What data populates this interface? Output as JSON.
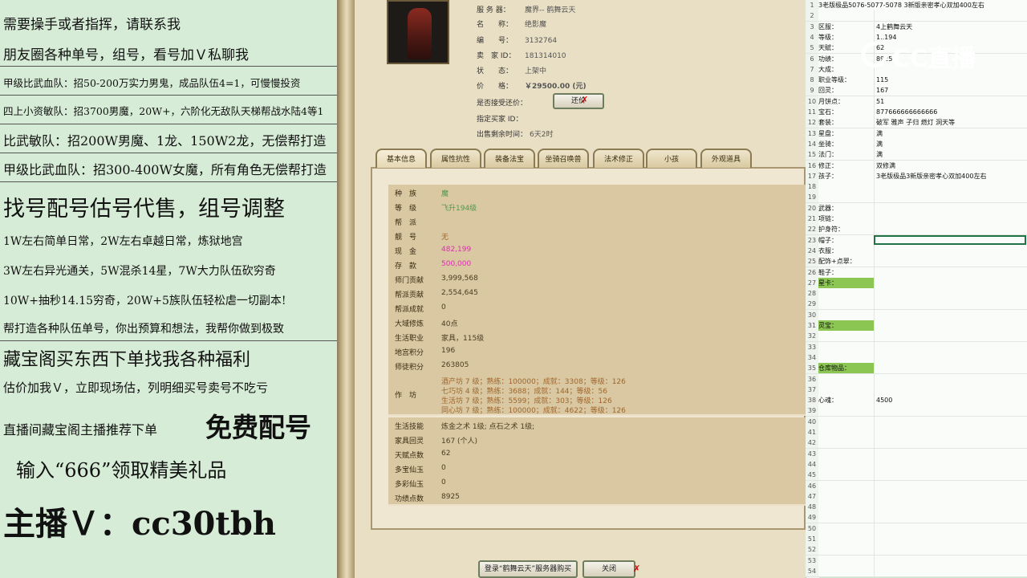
{
  "left_panel": {
    "lines": [
      "需要操手或者指挥，请联系我",
      "朋友圈各种单号，组号，看号加Ｖ私聊我",
      "甲级比武血队：招50-200万实力男鬼，成品队伍4=1，可慢慢投资",
      "四上小资敏队：招3700男魔，20W+，六阶化无敌队天梯帮战水陆4等1",
      "比武敏队：招200W男魔、1龙、150W2龙，无偿帮打造",
      "甲级比武血队：招300-400W女魔，所有角色无偿帮打造",
      "找号配号估号代售，组号调整",
      "1W左右简单日常，2W左右卓越日常，炼狱地宫",
      "3W左右异光通关，5W混杀14星，7W大力队伍砍穷奇",
      "10W+抽秒14.15穷奇，20W+5族队伍轻松虐一切副本!",
      "帮打造各种队伍单号，你出预算和想法，我帮你做到极致",
      "藏宝阁买东西下单找我各种福利",
      "估价加我Ｖ，立即现场估，列明细买号卖号不吃亏",
      "直播间藏宝阁主播推荐下单",
      "免费配号",
      "输入“666”领取精美礼品",
      "主播Ｖ：cc30tbh"
    ]
  },
  "item": {
    "server_label": "服 务 器：",
    "server": "魔界-- 鹤舞云天",
    "name_label": "名　　称：",
    "name": "绝影魔",
    "id_label": "编　　号：",
    "id": "3132764",
    "seller_label": "卖　家 ID：",
    "seller": "181314010",
    "status_label": "状　　态：",
    "status": "上架中",
    "price_label": "价　　格：",
    "price": "￥29500.00 (元)",
    "counter_label": "是否接受还价：",
    "counter_button": "还价",
    "buyer_label": "指定买家 ID：",
    "buyer": "",
    "time_label": "出售剩余时间：",
    "time": "6天2时"
  },
  "tabs": [
    "基本信息",
    "属性抗性",
    "装备法宝",
    "坐骑召唤兽",
    "法术修正",
    "小孩",
    "外观道具"
  ],
  "info_rows": [
    {
      "label": "种　族",
      "value": "魔",
      "style": "green"
    },
    {
      "label": "等　级",
      "value": "飞升194级",
      "style": "green"
    },
    {
      "label": "帮　派",
      "value": "",
      "style": ""
    },
    {
      "label": "靓　号",
      "value": "无",
      "style": "orange"
    },
    {
      "label": "现　金",
      "value": "482,199",
      "style": "pink"
    },
    {
      "label": "存　款",
      "value": "500,000",
      "style": "pink"
    },
    {
      "label": "师门贡献",
      "value": "3,999,568",
      "style": ""
    },
    {
      "label": "帮派贡献",
      "value": "2,554,645",
      "style": ""
    },
    {
      "label": "帮派成就",
      "value": "0",
      "style": ""
    },
    {
      "label": "大域修炼",
      "value": "40点",
      "style": ""
    },
    {
      "label": "生活职业",
      "value": "家具，115级",
      "style": ""
    },
    {
      "label": "地宫积分",
      "value": "196",
      "style": ""
    },
    {
      "label": "师徒积分",
      "value": "263805",
      "style": ""
    }
  ],
  "workshop": {
    "label": "作　坊",
    "lines": [
      "酒产坊 7 级；熟练：100000；成就：3308；等级：126",
      "七巧坊 4 级；熟练：3688；成就：144；等级：56",
      "生活坊 7 级；熟练：5599；成就：303；等级：126",
      "同心坊 7 级；熟练：100000；成就：4622；等级：126"
    ]
  },
  "info_rows2": [
    {
      "label": "生活技能",
      "value": "炼金之术 1级; 点石之术 1级;"
    },
    {
      "label": "家具回灵",
      "value": "167 (个人)"
    },
    {
      "label": "天赋点数",
      "value": "62"
    },
    {
      "label": "多宝仙玉",
      "value": "0"
    },
    {
      "label": "多彩仙玉",
      "value": "0"
    },
    {
      "label": "功绩点数",
      "value": "8925"
    }
  ],
  "bottom": {
    "login_button": "登录“鹤舞云天”服务器购买",
    "close_button": "关闭"
  },
  "sheet": {
    "header": "3老版极品5076-5077-5078 3新版亲密孝心双加400左右",
    "rows": [
      {
        "n": "1",
        "a": "3老版极品5076-5077-5078 3新版亲密孝心双加400左右",
        "b": "",
        "hl": false
      },
      {
        "n": "2",
        "a": "",
        "b": "",
        "hl": false
      },
      {
        "n": "3",
        "a": "区服：",
        "b": "4上鹤舞云天",
        "hl": false
      },
      {
        "n": "4",
        "a": "等级：",
        "b": "1..194",
        "hl": false
      },
      {
        "n": "5",
        "a": "天赋：",
        "b": "62",
        "hl": false
      },
      {
        "n": "6",
        "a": "功绩：",
        "b": "8925",
        "hl": false
      },
      {
        "n": "7",
        "a": "大成：",
        "b": "",
        "hl": false
      },
      {
        "n": "8",
        "a": "职业等级：",
        "b": "115",
        "hl": false
      },
      {
        "n": "9",
        "a": "回灵：",
        "b": "167",
        "hl": false
      },
      {
        "n": "10",
        "a": "月饼点：",
        "b": "51",
        "hl": false
      },
      {
        "n": "11",
        "a": "宝石：",
        "b": "877666666666666",
        "hl": false
      },
      {
        "n": "12",
        "a": "套装：",
        "b": "破军  雅声  子归  燃灯  洞天等",
        "hl": false
      },
      {
        "n": "13",
        "a": "星盘：",
        "b": "满",
        "hl": false
      },
      {
        "n": "14",
        "a": "坐骑：",
        "b": "满",
        "hl": false
      },
      {
        "n": "15",
        "a": "法门：",
        "b": "满",
        "hl": false
      },
      {
        "n": "16",
        "a": "修正：",
        "b": "双修满",
        "hl": false
      },
      {
        "n": "17",
        "a": "孩子：",
        "b": "3老版极品3新版亲密孝心双加400左右",
        "hl": false
      },
      {
        "n": "18",
        "a": "",
        "b": "",
        "hl": false
      },
      {
        "n": "19",
        "a": "",
        "b": "",
        "hl": false
      },
      {
        "n": "20",
        "a": "武器：",
        "b": "",
        "hl": false
      },
      {
        "n": "21",
        "a": "项链：",
        "b": "",
        "hl": false
      },
      {
        "n": "22",
        "a": "护身符：",
        "b": "",
        "hl": false
      },
      {
        "n": "23",
        "a": "帽子：",
        "b": "",
        "hl": false
      },
      {
        "n": "24",
        "a": "衣服：",
        "b": "",
        "hl": false
      },
      {
        "n": "25",
        "a": "配饰+点翠：",
        "b": "",
        "hl": false
      },
      {
        "n": "26",
        "a": "鞋子：",
        "b": "",
        "hl": false
      },
      {
        "n": "27",
        "a": "星卡：",
        "b": "",
        "hl": true
      },
      {
        "n": "28",
        "a": "",
        "b": "",
        "hl": false
      },
      {
        "n": "29",
        "a": "",
        "b": "",
        "hl": false
      },
      {
        "n": "30",
        "a": "",
        "b": "",
        "hl": false
      },
      {
        "n": "31",
        "a": "灵宝：",
        "b": "",
        "hl": true
      },
      {
        "n": "32",
        "a": "",
        "b": "",
        "hl": false
      },
      {
        "n": "33",
        "a": "",
        "b": "",
        "hl": false
      },
      {
        "n": "34",
        "a": "",
        "b": "",
        "hl": false
      },
      {
        "n": "35",
        "a": "仓库物品：",
        "b": "",
        "hl": true
      },
      {
        "n": "36",
        "a": "",
        "b": "",
        "hl": false
      },
      {
        "n": "37",
        "a": "",
        "b": "",
        "hl": false
      },
      {
        "n": "38",
        "a": "心魂：",
        "b": "4500",
        "hl": false
      },
      {
        "n": "39",
        "a": "",
        "b": "",
        "hl": false
      },
      {
        "n": "40",
        "a": "",
        "b": "",
        "hl": false
      },
      {
        "n": "41",
        "a": "",
        "b": "",
        "hl": false
      },
      {
        "n": "42",
        "a": "",
        "b": "",
        "hl": false
      },
      {
        "n": "43",
        "a": "",
        "b": "",
        "hl": false
      },
      {
        "n": "44",
        "a": "",
        "b": "",
        "hl": false
      },
      {
        "n": "45",
        "a": "",
        "b": "",
        "hl": false
      },
      {
        "n": "46",
        "a": "",
        "b": "",
        "hl": false
      },
      {
        "n": "47",
        "a": "",
        "b": "",
        "hl": false
      },
      {
        "n": "48",
        "a": "",
        "b": "",
        "hl": false
      },
      {
        "n": "49",
        "a": "",
        "b": "",
        "hl": false
      },
      {
        "n": "50",
        "a": "",
        "b": "",
        "hl": false
      },
      {
        "n": "51",
        "a": "",
        "b": "",
        "hl": false
      },
      {
        "n": "52",
        "a": "",
        "b": "",
        "hl": false
      },
      {
        "n": "53",
        "a": "",
        "b": "",
        "hl": false
      },
      {
        "n": "54",
        "a": "",
        "b": "",
        "hl": false
      }
    ]
  },
  "watermark": "CC直播"
}
